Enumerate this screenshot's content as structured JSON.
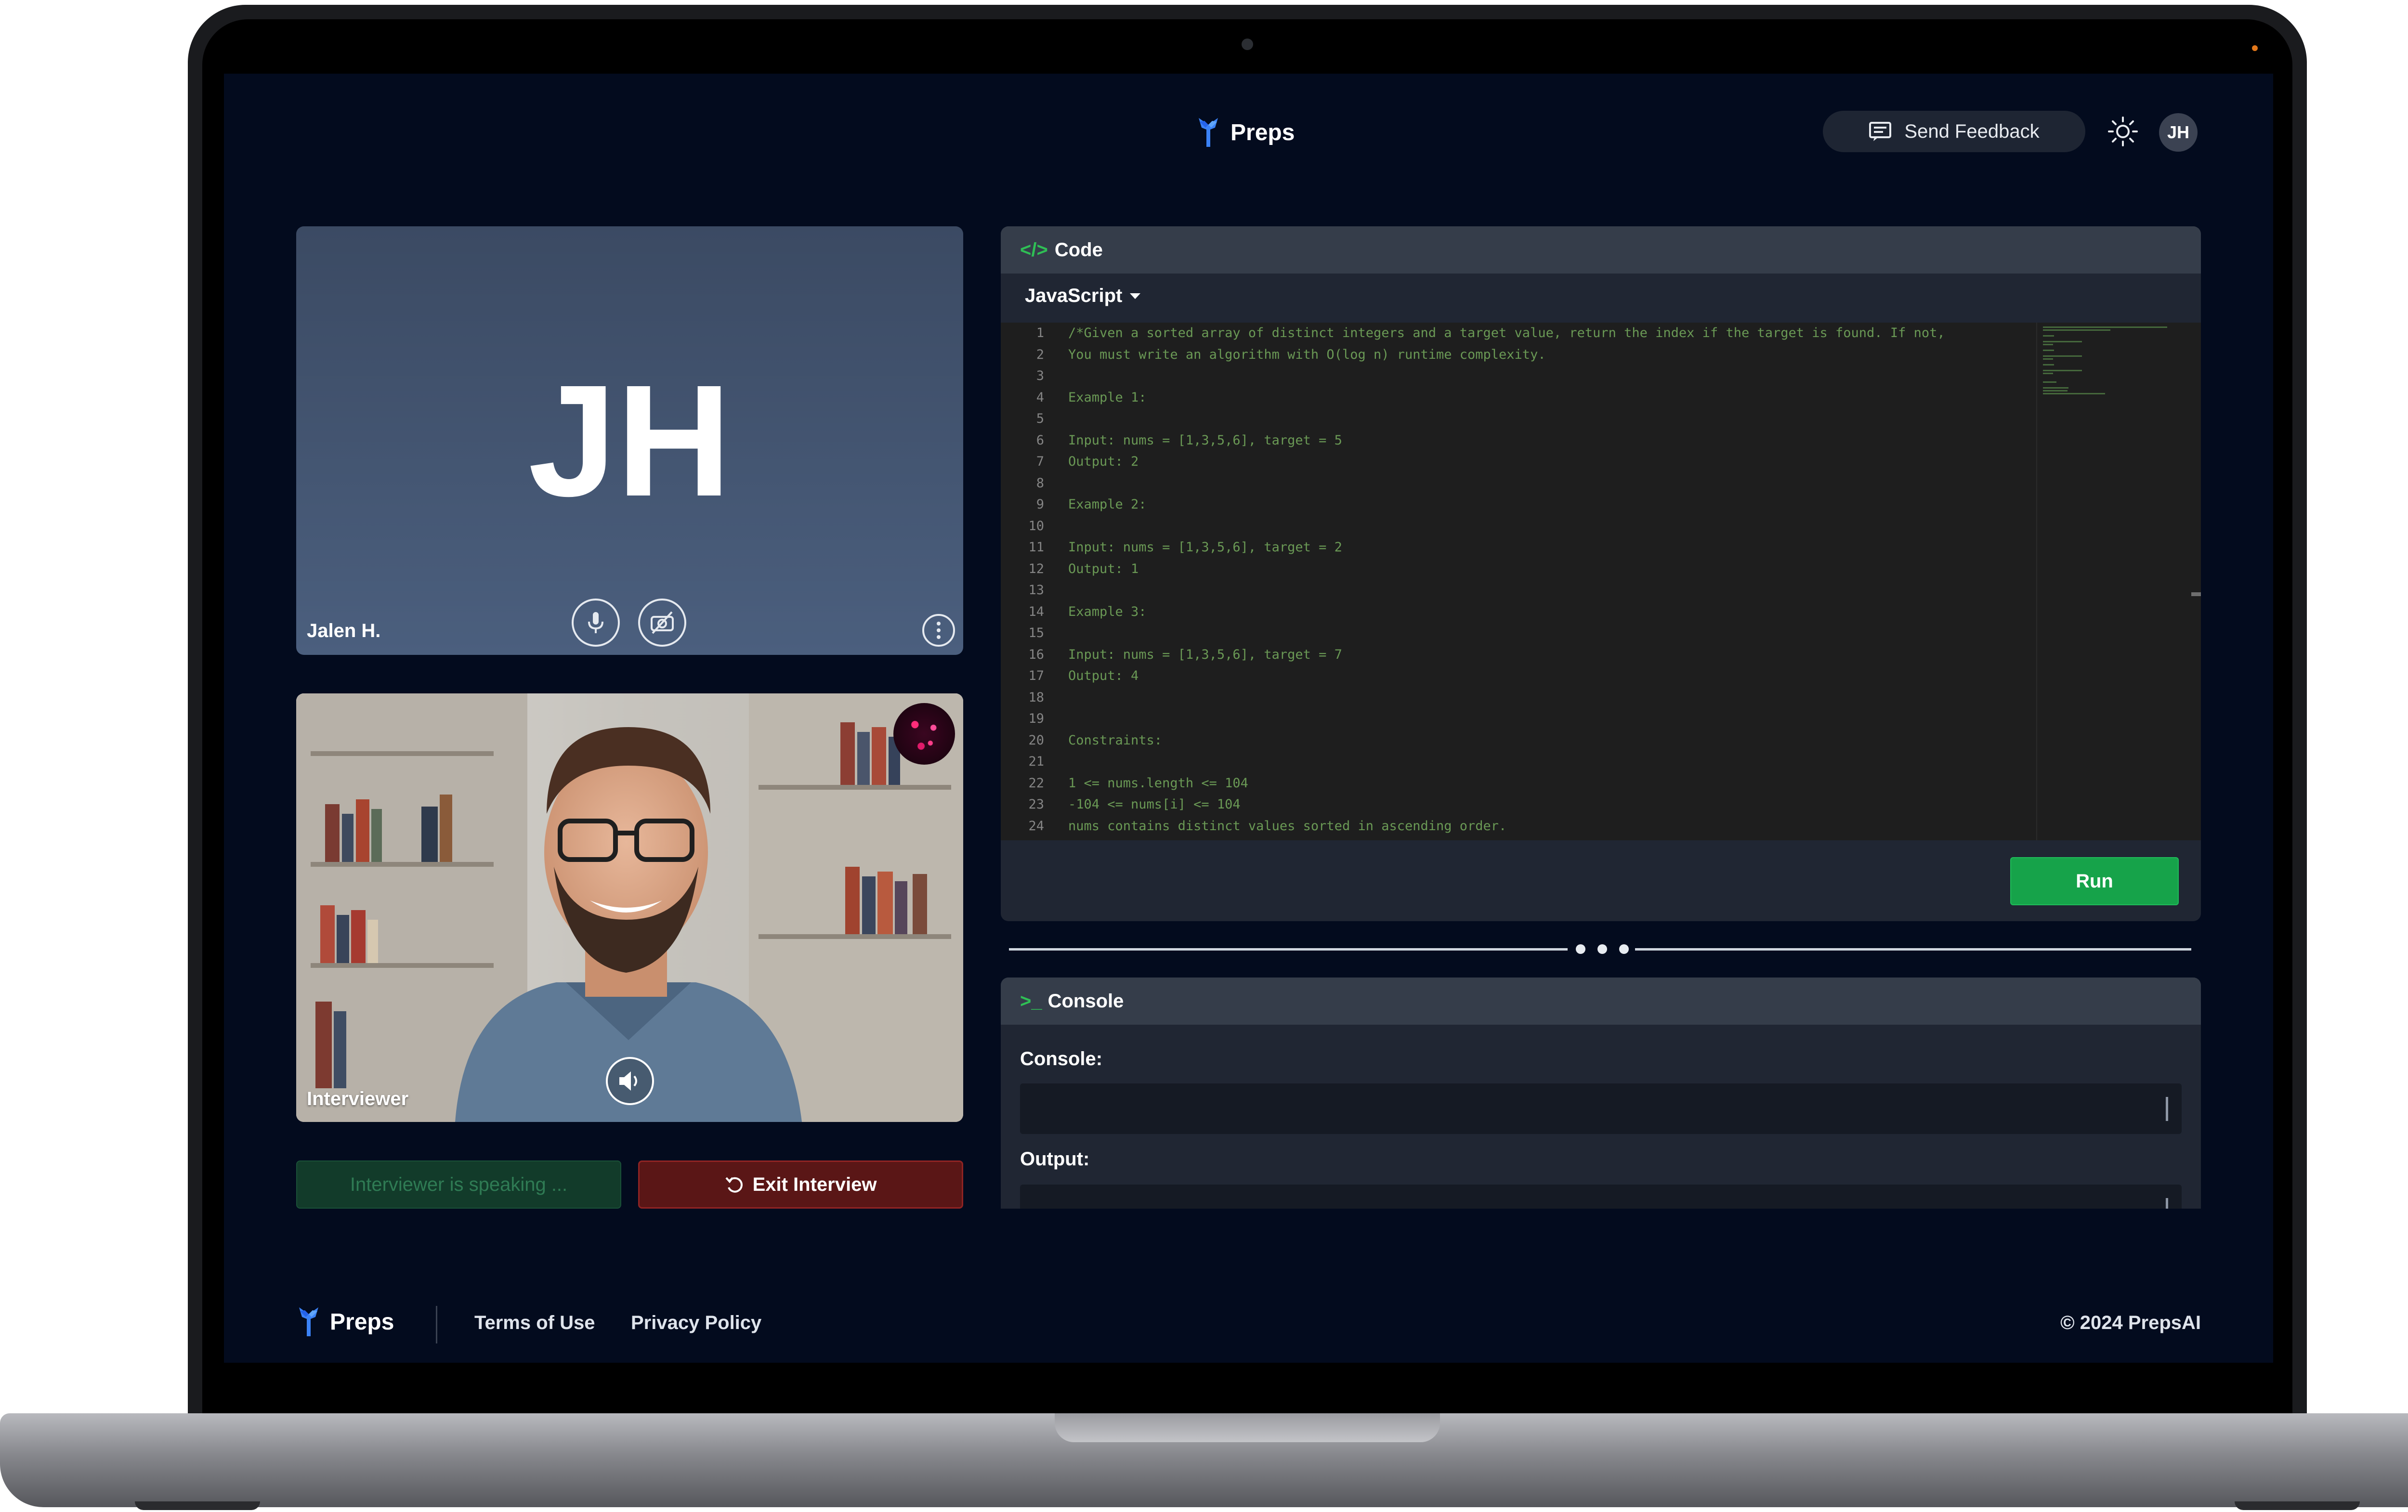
{
  "header": {
    "brand": "Preps",
    "feedback_label": "Send Feedback",
    "theme_icon": "sun-icon",
    "avatar_initials": "JH"
  },
  "candidate": {
    "initials": "JH",
    "name": "Jalen H.",
    "mic_icon": "microphone-icon",
    "camera_icon": "camera-off-icon",
    "menu_icon": "more-vertical-icon"
  },
  "interviewer": {
    "label": "Interviewer",
    "speaker_icon": "speaker-icon"
  },
  "actions": {
    "status_label": "Interviewer is speaking ...",
    "exit_label": "Exit Interview"
  },
  "code": {
    "title_tag": "</>",
    "title": "Code",
    "language": "JavaScript",
    "lines": [
      {
        "n": "1",
        "t": "/*Given a sorted array of distinct integers and a target value, return the index if the target is found. If not,"
      },
      {
        "n": "2",
        "t": "You must write an algorithm with O(log n) runtime complexity."
      },
      {
        "n": "3",
        "t": ""
      },
      {
        "n": "4",
        "t": "Example 1:"
      },
      {
        "n": "5",
        "t": ""
      },
      {
        "n": "6",
        "t": "Input: nums = [1,3,5,6], target = 5"
      },
      {
        "n": "7",
        "t": "Output: 2"
      },
      {
        "n": "8",
        "t": ""
      },
      {
        "n": "9",
        "t": "Example 2:"
      },
      {
        "n": "10",
        "t": ""
      },
      {
        "n": "11",
        "t": "Input: nums = [1,3,5,6], target = 2"
      },
      {
        "n": "12",
        "t": "Output: 1"
      },
      {
        "n": "13",
        "t": ""
      },
      {
        "n": "14",
        "t": "Example 3:"
      },
      {
        "n": "15",
        "t": ""
      },
      {
        "n": "16",
        "t": "Input: nums = [1,3,5,6], target = 7"
      },
      {
        "n": "17",
        "t": "Output: 4"
      },
      {
        "n": "18",
        "t": ""
      },
      {
        "n": "19",
        "t": ""
      },
      {
        "n": "20",
        "t": "Constraints:"
      },
      {
        "n": "21",
        "t": ""
      },
      {
        "n": "22",
        "t": "1 <= nums.length <= 104"
      },
      {
        "n": "23",
        "t": "-104 <= nums[i] <= 104"
      },
      {
        "n": "24",
        "t": "nums contains distinct values sorted in ascending order."
      }
    ],
    "run_label": "Run"
  },
  "console": {
    "title_tag": ">_",
    "title": "Console",
    "console_label": "Console:",
    "output_label": "Output:"
  },
  "footer": {
    "brand": "Preps",
    "terms": "Terms of Use",
    "privacy": "Privacy Policy",
    "copyright": "© 2024 PrepsAI"
  },
  "colors": {
    "background": "#030b1e",
    "panel": "#202633",
    "panel_header": "#353d4a",
    "run_green": "#16a34a",
    "exit_red": "#5a1616",
    "status_green": "#123b2a",
    "logo_blue": "#3b82f6"
  }
}
